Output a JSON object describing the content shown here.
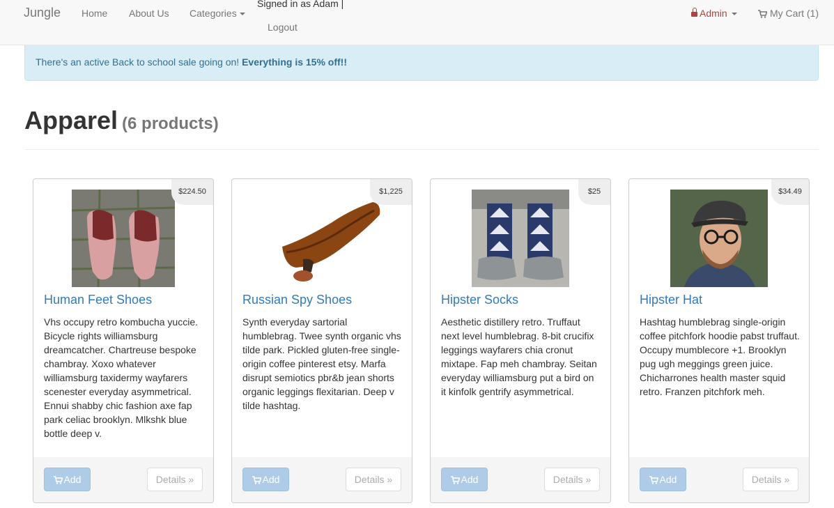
{
  "navbar": {
    "brand": "Jungle",
    "links": [
      "Home",
      "About Us",
      "Categories"
    ],
    "signed_in": "Signed in as Adam |",
    "logout": "Logout",
    "admin": "Admin",
    "cart": "My Cart (1)"
  },
  "alert": {
    "text": "There's an active Back to school sale going on!",
    "emphasis": "Everything is 15% off!!"
  },
  "page": {
    "title": "Apparel",
    "count": "(6 products)"
  },
  "buttons": {
    "add": "Add",
    "details": "Details »"
  },
  "products": [
    {
      "name": "Human Feet Shoes",
      "price": "$224.50",
      "description": "Vhs occupy retro kombucha yuccie. Bicycle rights williamsburg dreamcatcher. Chartreuse bespoke chambray. Xoxo whatever williamsburg taxidermy wayfarers scenester everyday asymmetrical. Ennui shabby chic fashion axe fap park celiac brooklyn. Mlkshk blue bottle deep v."
    },
    {
      "name": "Russian Spy Shoes",
      "price": "$1,225",
      "description": "Synth everyday sartorial humblebrag. Twee synth organic vhs tilde park. Pickled gluten-free single-origin coffee pinterest etsy. Marfa disrupt semiotics pbr&b jean shorts organic leggings flexitarian. Deep v tilde hashtag."
    },
    {
      "name": "Hipster Socks",
      "price": "$25",
      "description": "Aesthetic distillery retro. Truffaut next level humblebrag. 8-bit crucifix leggings wayfarers chia cronut mixtape. Fap meh chambray. Seitan everyday williamsburg put a bird on it kinfolk gentrify asymmetrical."
    },
    {
      "name": "Hipster Hat",
      "price": "$34.49",
      "description": "Hashtag humblebrag single-origin coffee pitchfork hoodie pabst truffaut. Occupy mumblecore +1. Brooklyn pug ugh meggings green juice. Chicharrones health master squid retro. Franzen pitchfork meh."
    }
  ]
}
